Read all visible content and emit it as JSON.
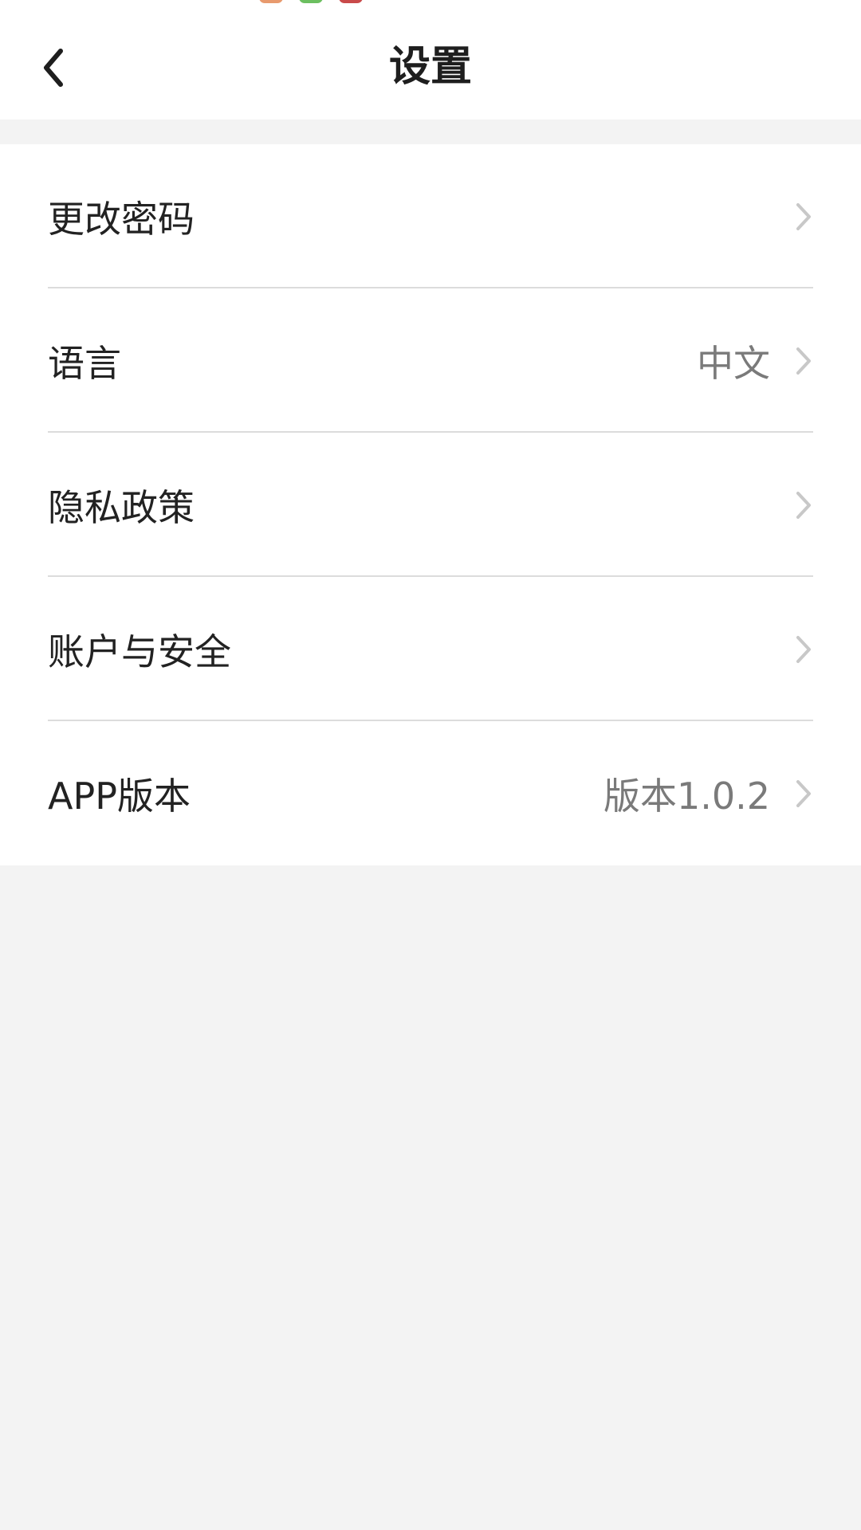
{
  "header": {
    "title": "设置",
    "back_icon": "chevron-left-icon"
  },
  "settings": {
    "items": [
      {
        "label": "更改密码",
        "value": ""
      },
      {
        "label": "语言",
        "value": "中文"
      },
      {
        "label": "隐私政策",
        "value": ""
      },
      {
        "label": "账户与安全",
        "value": ""
      },
      {
        "label": "APP版本",
        "value": "版本1.0.2"
      }
    ],
    "chevron_icon": "chevron-right-icon"
  },
  "colors": {
    "background": "#f3f3f3",
    "surface": "#ffffff",
    "text_primary": "#222222",
    "text_secondary": "#7a7a7a",
    "chevron": "#c8c8c8",
    "divider": "#dcdcdc"
  }
}
